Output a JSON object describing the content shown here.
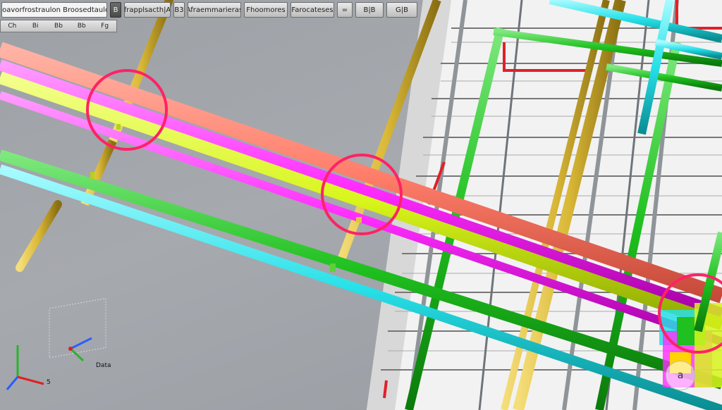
{
  "toolbar": {
    "title": "Trooavorfrostraulon Broosedtaulobr",
    "buttons": [
      {
        "label": "B",
        "dark": true
      },
      {
        "label": "frapplsacth|A",
        "dark": false
      },
      {
        "label": "B3",
        "dark": false
      },
      {
        "label": "Afraemmarieras",
        "dark": false
      },
      {
        "label": "Fhoomores",
        "dark": false
      },
      {
        "label": "Farocateses",
        "dark": false
      },
      {
        "label": "=",
        "dark": false
      },
      {
        "label": "B|B",
        "dark": false
      },
      {
        "label": "G|B",
        "dark": false
      }
    ]
  },
  "subbar": {
    "items": [
      "Ch",
      "Bi",
      "Bb",
      "Bb",
      "Fg"
    ]
  },
  "axis": {
    "label_x": "5",
    "label_data": "Data"
  },
  "badge": {
    "label": "a"
  },
  "colors": {
    "pipe_salmon": "#ff7f6b",
    "pipe_magenta": "#ff2bff",
    "pipe_lime": "#d8f51c",
    "pipe_green": "#1fc01f",
    "pipe_cyan": "#27e0e8",
    "pipe_yellow": "#d9b736",
    "highlight_ring": "#ff2266"
  }
}
